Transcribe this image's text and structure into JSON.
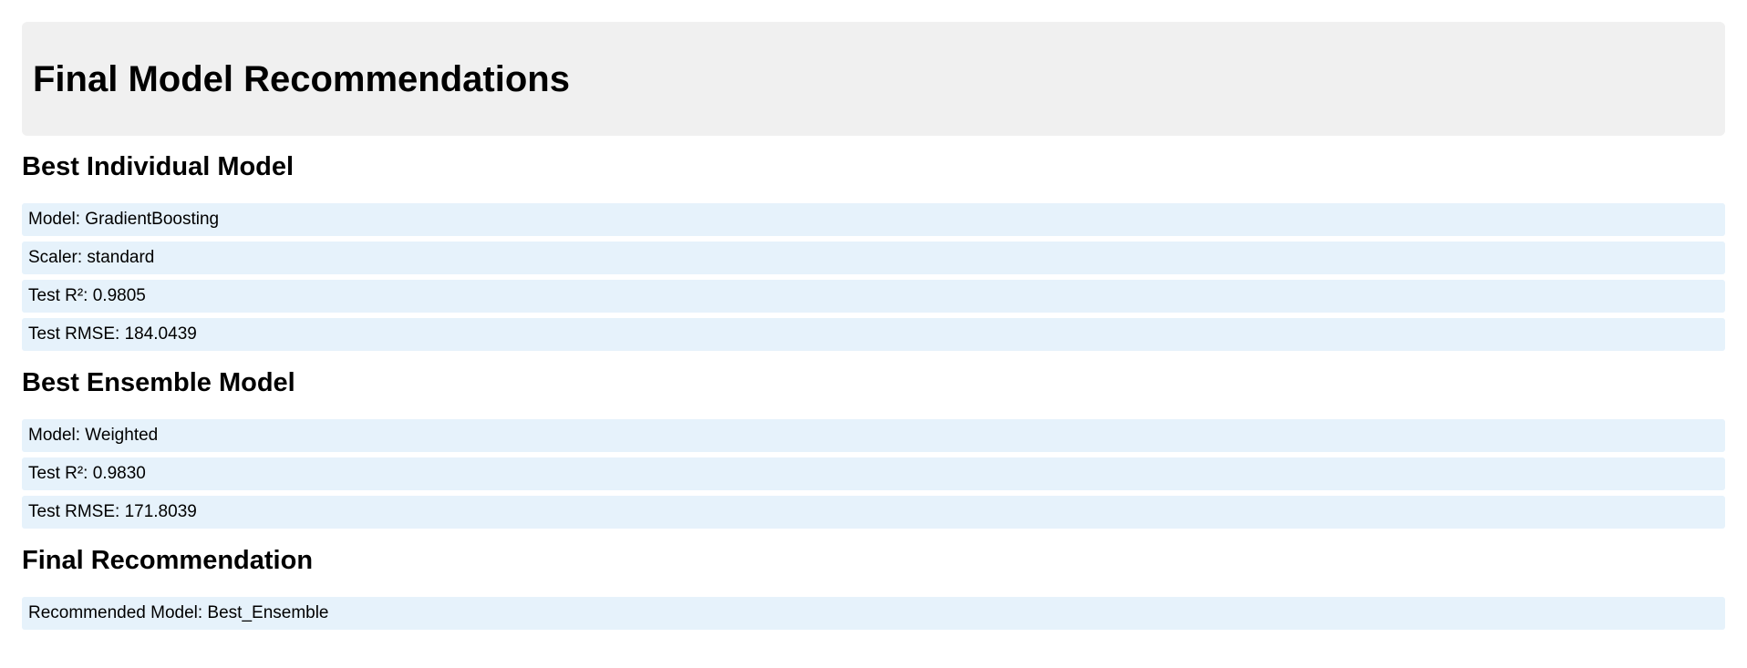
{
  "page": {
    "title": "Final Model Recommendations"
  },
  "sections": [
    {
      "title": "Best Individual Model",
      "rows": [
        "Model: GradientBoosting",
        "Scaler: standard",
        "Test R²: 0.9805",
        "Test RMSE: 184.0439"
      ]
    },
    {
      "title": "Best Ensemble Model",
      "rows": [
        "Model: Weighted",
        "Test R²: 0.9830",
        "Test RMSE: 171.8039"
      ]
    },
    {
      "title": "Final Recommendation",
      "rows": [
        "Recommended Model: Best_Ensemble"
      ]
    }
  ],
  "colors": {
    "header_background": "#f0f0f0",
    "row_background": "#e6f2fb",
    "text": "#000000"
  }
}
